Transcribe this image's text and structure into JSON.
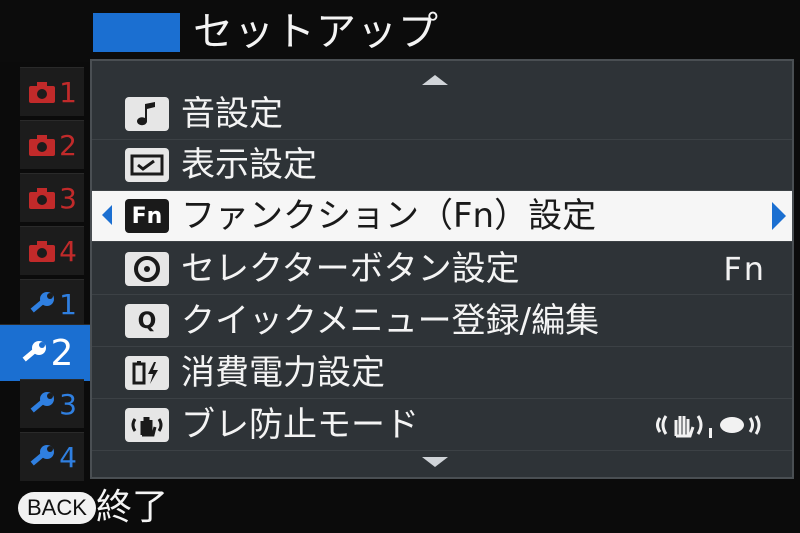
{
  "header": {
    "title": "セットアップ",
    "accent_color": "#1b6fd1"
  },
  "sidebar": {
    "tabs": [
      {
        "icon": "camera-icon",
        "number": "1",
        "color": "#c12a2a",
        "active": false
      },
      {
        "icon": "camera-icon",
        "number": "2",
        "color": "#c12a2a",
        "active": false
      },
      {
        "icon": "camera-icon",
        "number": "3",
        "color": "#c12a2a",
        "active": false
      },
      {
        "icon": "camera-icon",
        "number": "4",
        "color": "#c12a2a",
        "active": false
      },
      {
        "icon": "wrench-icon",
        "number": "1",
        "color": "#2f7fe0",
        "active": false
      },
      {
        "icon": "wrench-icon",
        "number": "2",
        "color": "#ffffff",
        "active": true
      },
      {
        "icon": "wrench-icon",
        "number": "3",
        "color": "#2f7fe0",
        "active": false
      },
      {
        "icon": "wrench-icon",
        "number": "4",
        "color": "#2f7fe0",
        "active": false
      }
    ]
  },
  "menu": {
    "items": [
      {
        "icon": "music-note-icon",
        "label": "音設定",
        "value": ""
      },
      {
        "icon": "display-icon",
        "label": "表示設定",
        "value": ""
      },
      {
        "icon": "fn-icon",
        "icon_text": "Fn",
        "label": "ファンクション（Fn）設定",
        "value": "",
        "selected": true
      },
      {
        "icon": "dpad-icon",
        "label": "セレクターボタン設定",
        "value": "Fn"
      },
      {
        "icon": "q-icon",
        "icon_text": "Q",
        "label": "クイックメニュー登録/編集",
        "value": ""
      },
      {
        "icon": "battery-icon",
        "label": "消費電力設定",
        "value": ""
      },
      {
        "icon": "stabilizer-icon",
        "label": "ブレ防止モード",
        "value": "",
        "value_icon": "stabilizer-continuous-icon"
      }
    ]
  },
  "footer": {
    "back_button": "BACK",
    "label": "終了"
  }
}
